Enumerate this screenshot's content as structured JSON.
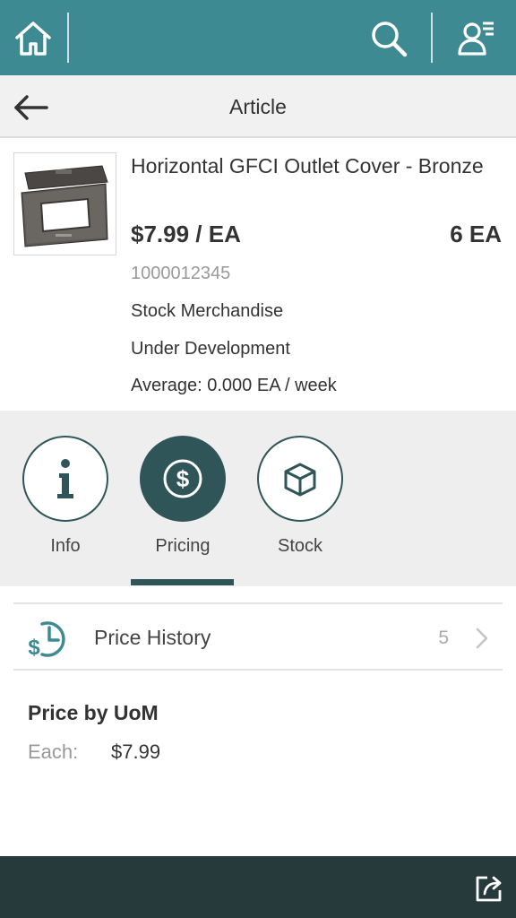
{
  "header": {
    "home_icon": "home-icon",
    "search_icon": "search-icon",
    "user_icon": "user-menu-icon",
    "color": "#3e8a93"
  },
  "subheader": {
    "title": "Article",
    "back_icon": "arrow-left-icon"
  },
  "article": {
    "title": "Horizontal GFCI Outlet Cover - Bronze",
    "price": "$7.99 / EA",
    "quantity": "6 EA",
    "id": "1000012345",
    "category": "Stock Merchandise",
    "status": "Under Development",
    "average": "Average: 0.000 EA / week"
  },
  "tabs": [
    {
      "label": "Info",
      "icon": "info-icon",
      "active": false
    },
    {
      "label": "Pricing",
      "icon": "dollar-icon",
      "active": true
    },
    {
      "label": "Stock",
      "icon": "box-icon",
      "active": false
    }
  ],
  "price_history": {
    "label": "Price History",
    "count": "5",
    "icon": "price-history-icon"
  },
  "uom": {
    "title": "Price by UoM",
    "label": "Each:",
    "value": "$7.99"
  },
  "footer": {
    "share_icon": "share-icon",
    "color": "#26393b"
  }
}
